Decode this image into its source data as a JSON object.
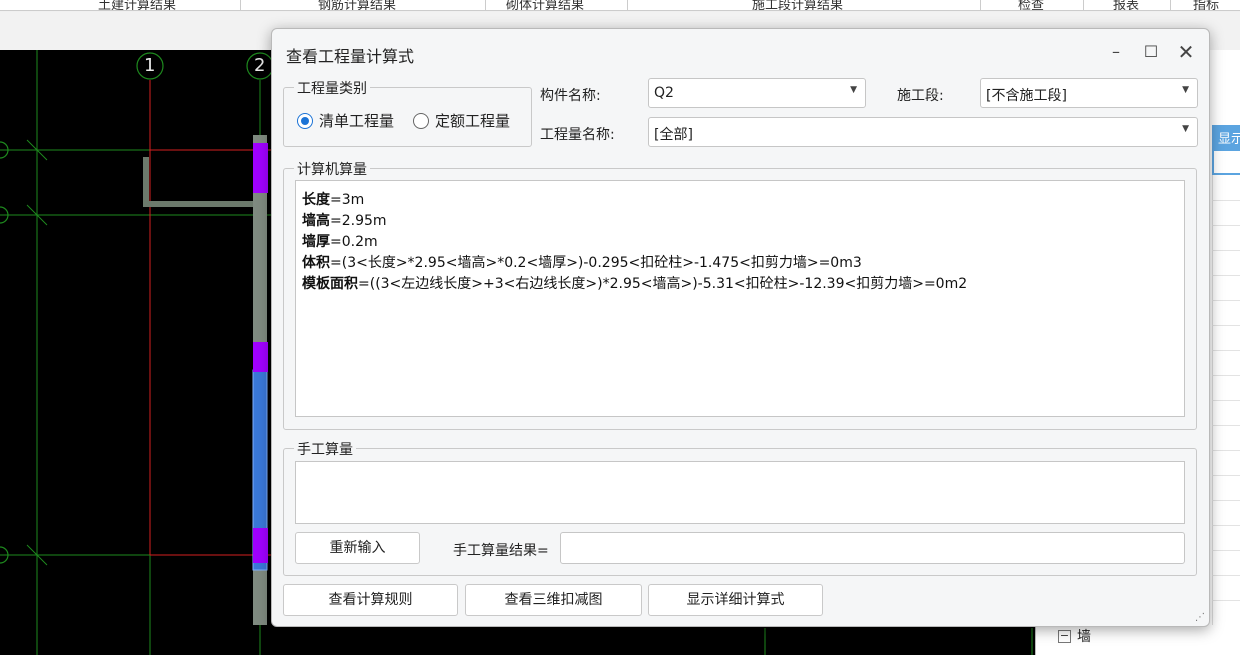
{
  "toolbar": {
    "items": [
      "土建计算结果",
      "钢筋计算结果",
      "砌体计算结果",
      "施工段计算结果",
      "检查",
      "报表",
      "指标"
    ]
  },
  "cad": {
    "axis_labels": [
      "1",
      "2"
    ]
  },
  "right_panel": {
    "header_text": "显示",
    "tree_toggle": "−",
    "tree_label": "墙"
  },
  "dialog": {
    "title": "查看工程量计算式",
    "min_glyph": "–",
    "max_glyph": "☐",
    "close_glyph": "✕",
    "category_group": {
      "legend": "工程量类别",
      "options": [
        {
          "label": "清单工程量",
          "selected": true
        },
        {
          "label": "定额工程量",
          "selected": false
        }
      ]
    },
    "component_name": {
      "label": "构件名称:",
      "value": "Q2"
    },
    "construction_stage": {
      "label": "施工段:",
      "value": "[不含施工段]"
    },
    "quantity_name": {
      "label": "工程量名称:",
      "value": "[全部]"
    },
    "computer_calc": {
      "legend": "计算机算量",
      "lines": [
        {
          "key": "长度",
          "expr": "=3m"
        },
        {
          "key": "墙高",
          "expr": "=2.95m"
        },
        {
          "key": "墙厚",
          "expr": "=0.2m"
        },
        {
          "key": "体积",
          "expr": "=(3<长度>*2.95<墙高>*0.2<墙厚>)-0.295<扣砼柱>-1.475<扣剪力墙>=0m3"
        },
        {
          "key": "模板面积",
          "expr": "=((3<左边线长度>+3<右边线长度>)*2.95<墙高>)-5.31<扣砼柱>-12.39<扣剪力墙>=0m2"
        }
      ]
    },
    "manual_calc": {
      "legend": "手工算量",
      "reenter_button": "重新输入",
      "result_label": "手工算量结果="
    },
    "buttons": {
      "view_rules": "查看计算规则",
      "view_3d": "查看三维扣减图",
      "show_detail": "显示详细计算式"
    }
  },
  "colors": {
    "accent": "#1b73d6",
    "cad_background": "#000000",
    "column_magenta": "#a000ff",
    "wall_blue": "#3a78d8",
    "grid_green": "#1e8a1e",
    "axis_red": "#d42020"
  }
}
